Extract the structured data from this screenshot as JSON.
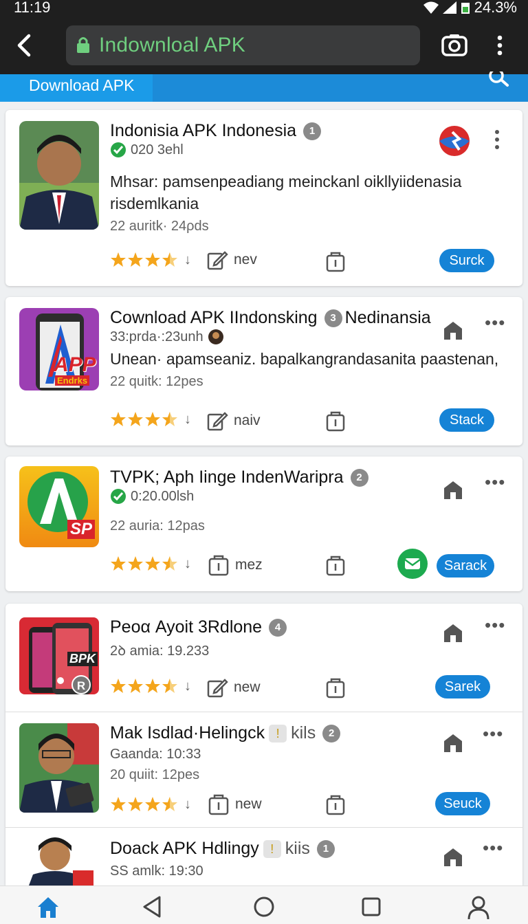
{
  "status": {
    "time": "11:19",
    "battery": "24.3%"
  },
  "browser": {
    "url": "Indownloal APK"
  },
  "tab": {
    "label": "Download APK"
  },
  "apps": [
    {
      "title": "Indonisia APK Indonesia",
      "badge": "1",
      "meta": "020 3ehl",
      "description": "Mhsar: pamsenpeadiang meinckanl oikllyiidenasia risdemlkania",
      "stats": "22 auritk· 24ρds",
      "rating": 3.5,
      "action_label": "nev",
      "button": "Surck"
    },
    {
      "title": "Cownload APK IIndonsking",
      "badge": "3",
      "title_suffix": "Nedinansia",
      "meta": "33:prda·:23unh",
      "description": "Unean· apamseaniz. bapalkangrandasanita paastenan,",
      "stats": "22 quitk: 12pes",
      "rating": 3.5,
      "action_label": "naiv",
      "button": "Stack",
      "thumb_text": "APP",
      "thumb_sub": "Endrks"
    },
    {
      "title": "TVPK; Aph Iinge IndenWaripra",
      "badge": "2",
      "meta": "0:20.00lsh",
      "stats": "22 auria: 12pas",
      "rating": 3.5,
      "action_label": "mez",
      "button": "Sarack",
      "thumb_text": "SP"
    },
    {
      "title": "Peoα Ayoit 3Rdlone",
      "badge": "4",
      "meta": "2ꝺ amia: 19.233",
      "rating": 3.5,
      "action_label": "new",
      "button": "Sarek",
      "thumb_text": "BPK",
      "thumb_badge": "R"
    },
    {
      "title": "Mak Isdlad·Helingck",
      "level": "kils",
      "badge": "2",
      "meta": "Gaanda: 10:33",
      "stats": "20 quiit: 12pes",
      "rating": 3.5,
      "action_label": "new",
      "button": "Seuck"
    },
    {
      "title": "Doack APK Hdlingy",
      "level": "kiis",
      "badge": "1",
      "meta": "SS amlk: 19:30"
    }
  ],
  "colors": {
    "accent": "#1583d6",
    "url_text": "#6fcf7f",
    "star": "#f4a51c"
  }
}
